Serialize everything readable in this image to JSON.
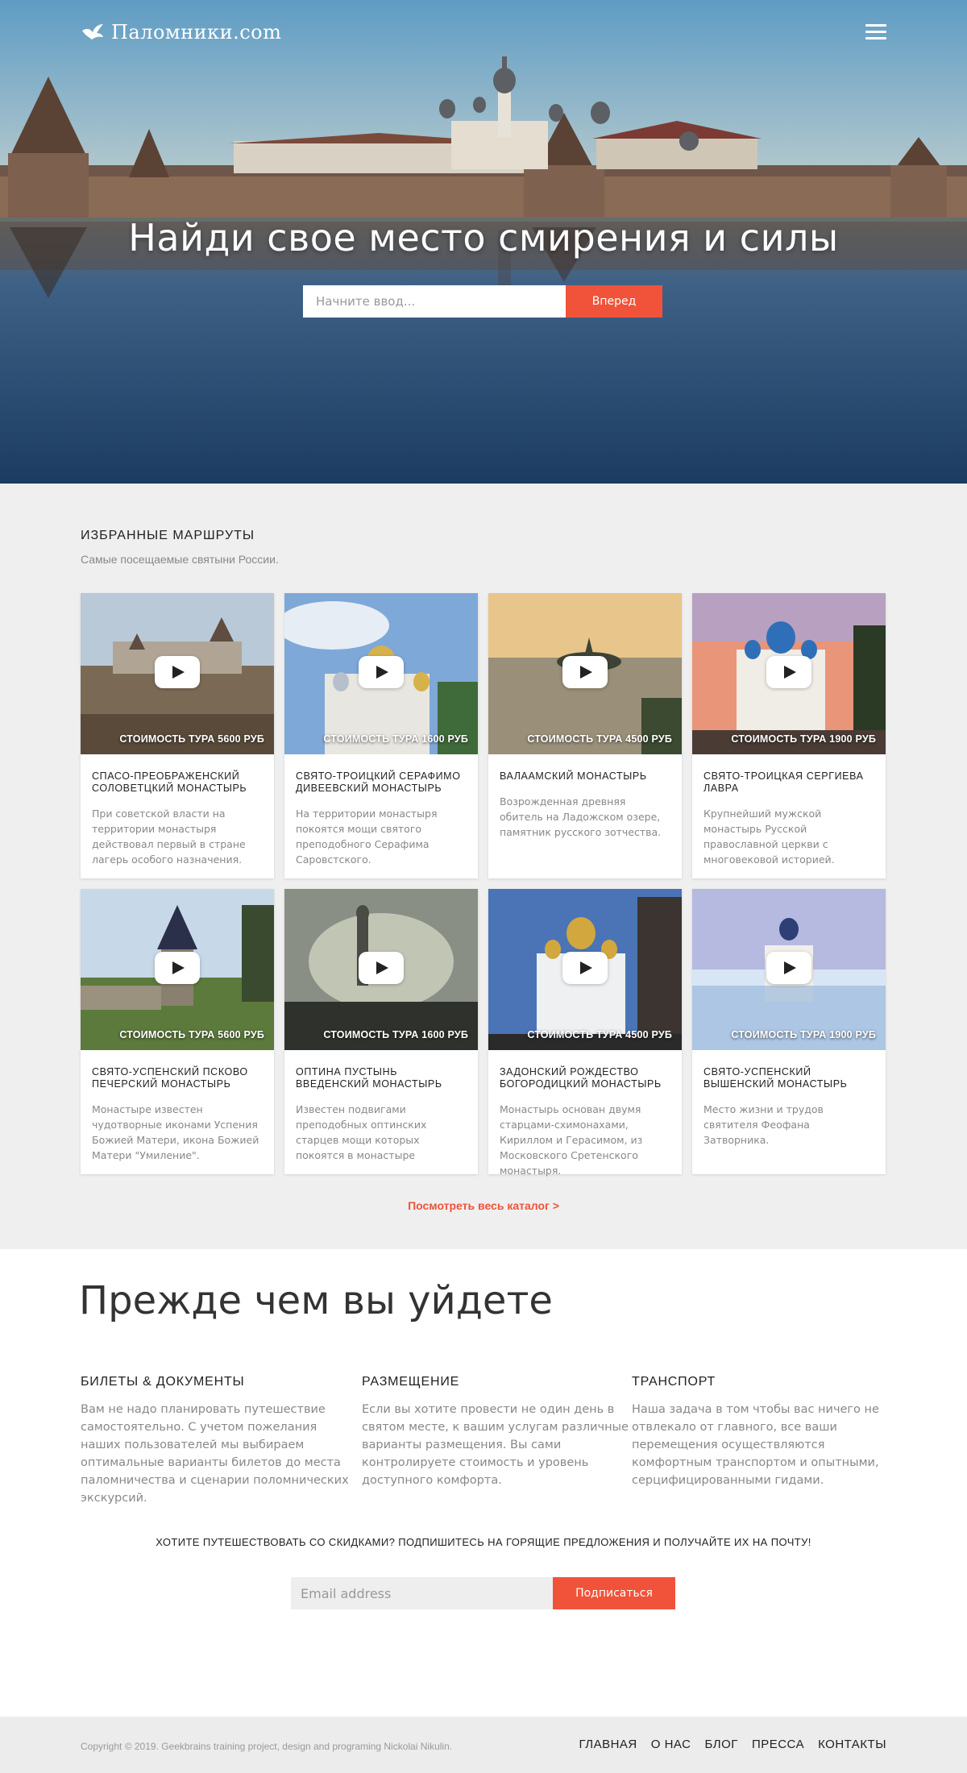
{
  "header": {
    "logo_text": "Паломники.com",
    "logo_icon": "dove-icon",
    "menu_icon": "hamburger-icon"
  },
  "hero": {
    "title": "Найди свое место смирения и силы",
    "search_placeholder": "Начните ввод...",
    "search_button": "Вперед"
  },
  "routes": {
    "title": "ИЗБРАННЫЕ МАРШРУТЫ",
    "subtitle": "Самые посещаемые святыни России.",
    "cards": [
      {
        "price": "СТОИМОСТЬ ТУРА 5600 РУБ",
        "title": "СПАСО-ПРЕОБРАЖЕНСКИЙ СОЛОВЕТЦКИЙ МОНАСТЫРЬ",
        "text": "При советской власти на территории монастыря действовал первый в стране лагерь особого назначения."
      },
      {
        "price": "СТОИМОСТЬ ТУРА 1600 РУБ",
        "title": "СВЯТО-ТРОИЦКИЙ СЕРАФИМО ДИВЕЕВСКИЙ МОНАСТЫРЬ",
        "text": "На территории монастыря покоятся мощи святого преподобного Серафима Саровстского."
      },
      {
        "price": "СТОИМОСТЬ ТУРА 4500 РУБ",
        "title": "ВАЛААМСКИЙ МОНАСТЫРЬ",
        "text": "Возрожденная древняя обитель на Ладожском озере, памятник русского зотчества."
      },
      {
        "price": "СТОИМОСТЬ ТУРА 1900 РУБ",
        "title": "СВЯТО-ТРОИЦКАЯ СЕРГИЕВА ЛАВРА",
        "text": "Крупнейший мужской монастырь Русской православной церкви с многовековой историей."
      },
      {
        "price": "СТОИМОСТЬ ТУРА 5600 РУБ",
        "title": "СВЯТО-УСПЕНСКИЙ ПСКОВО ПЕЧЕРСКИЙ МОНАСТЫРЬ",
        "text": "Монастыре известен чудотворные иконами Успения Божией Матери, икона Божией Матери \"Умиление\"."
      },
      {
        "price": "СТОИМОСТЬ ТУРА 1600 РУБ",
        "title": "ОПТИНА ПУСТЫНЬ ВВЕДЕНСКИЙ МОНАСТЫРЬ",
        "text": "Известен подвигами преподобных оптинских старцев мощи которых покоятся в монастыре"
      },
      {
        "price": "СТОИМОСТЬ ТУРА 4500 РУБ",
        "title": "ЗАДОНСКИЙ РОЖДЕСТВО БОГОРОДИЦКИЙ МОНАСТЫРЬ",
        "text": "Монастырь основан двумя старцами-схимонахами, Кириллом и Герасимом, из Московского Сретенского монастыря."
      },
      {
        "price": "СТОИМОСТЬ ТУРА 1900 РУБ",
        "title": "СВЯТО-УСПЕНСКИЙ ВЫШЕНСКИЙ МОНАСТЫРЬ",
        "text": "Место жизни и трудов святителя Феофана Затворника."
      }
    ],
    "catalog_link": "Посмотреть весь каталог >"
  },
  "before": {
    "title": "Прежде чем вы уйдете",
    "columns": [
      {
        "title": "БИЛЕТЫ & ДОКУМЕНТЫ",
        "text": "Вам не надо планировать путешествие самостоятельно. С учетом пожелания наших пользователей мы выбираем оптимальные варианты билетов до места паломничества и сценарии поломнических экскурсий."
      },
      {
        "title": "РАЗМЕЩЕНИЕ",
        "text": "Если вы хотите провести не один день в святом месте, к вашим услугам различные варианты размещения. Вы сами контролируете стоимость и уровень доступного комфорта."
      },
      {
        "title": "ТРАНСПОРТ",
        "text": "Наша задача в том чтобы вас ничего не отвлекало от главного, все ваши перемещения осуществляются комфортным транспортом и опытными, серцифицированными гидами."
      }
    ],
    "promo": "ХОТИТЕ ПУТЕШЕСТВОВАТЬ СО СКИДКАМИ? ПОДПИШИТЕСЬ НА ГОРЯЩИЕ ПРЕДЛОЖЕНИЯ И ПОЛУЧАЙТЕ ИХ НА ПОЧТУ!",
    "email_placeholder": "Email address",
    "subscribe_button": "Подписаться"
  },
  "footer": {
    "copyright": "Copyright © 2019. Geekbrains training project, design and programing Nickolai Nikulin.",
    "nav": [
      "ГЛАВНАЯ",
      "О НАС",
      "БЛОГ",
      "ПРЕССА",
      "КОНТАКТЫ"
    ]
  },
  "colors": {
    "accent": "#f0533a",
    "section_bg": "#efefef",
    "footer_bg": "#ececec"
  }
}
